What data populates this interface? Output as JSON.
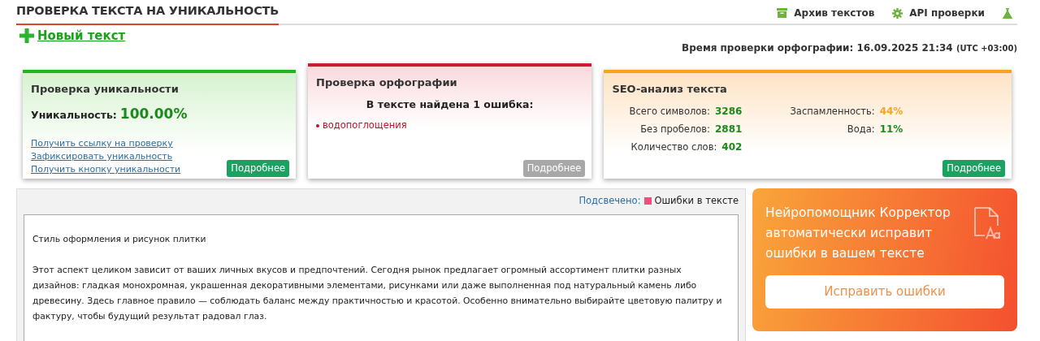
{
  "header": {
    "title": "ПРОВЕРКА ТЕКСТА НА УНИКАЛЬНОСТЬ",
    "links": [
      {
        "label": "Архив текстов",
        "kind": "archive"
      },
      {
        "label": "API проверки",
        "kind": "api"
      },
      {
        "kind": "lab"
      }
    ]
  },
  "new_text": {
    "label": "Новый текст"
  },
  "check_time": {
    "label": "Время проверки орфографии: 16.09.2025 21:34",
    "zone": "(UTC +03:00)"
  },
  "cards": [
    {
      "kind": "uniqueness",
      "title": "Проверка уникальности",
      "metric_label": "Уникальность:",
      "metric_value": "100.00%",
      "links": [
        "Получить ссылку на проверку",
        "Зафиксировать уникальность",
        "Получить кнопку уникальности"
      ],
      "button": {
        "label": "Подробнее",
        "disabled": false
      }
    },
    {
      "kind": "spelling",
      "title": "Проверка орфографии",
      "summary": "В тексте найдена 1 ошибка:",
      "errors": [
        "водопоглощения"
      ],
      "button": {
        "label": "Подробнее",
        "disabled": true
      }
    },
    {
      "kind": "seo",
      "title": "SEO-анализ текста",
      "stats_left": [
        {
          "label": "Всего символов:",
          "value": "3286",
          "color": "#1a8a1a"
        },
        {
          "label": "Без пробелов:",
          "value": "2881",
          "color": "#1a8a1a"
        },
        {
          "label": "Количество слов:",
          "value": "402",
          "color": "#1a8a1a"
        }
      ],
      "stats_right": [
        {
          "label": "Заспамленность:",
          "value": "44%",
          "color": "#f5a623"
        },
        {
          "label": "Вода:",
          "value": "11%",
          "color": "#1a8a1a"
        }
      ],
      "button": {
        "label": "Подробнее",
        "disabled": false
      }
    }
  ],
  "editor": {
    "highlight_label": "Подсвечено:",
    "legend": {
      "label": "Ошибки в тексте",
      "color": "#f0507a"
    },
    "paragraphs": [
      "Стиль оформления и рисунок плитки",
      "Этот аспект целиком зависит от ваших личных вкусов и предпочтений. Сегодня рынок предлагает огромный ассортимент плитки разных дизайнов: гладкая монохромная, украшенная декоративными элементами, рисунками или даже выполненная под натуральный камень либо древесину. Здесь главное правило — соблюдать баланс между практичностью и красотой. Особенно внимательно выбирайте цветовую палитру и фактуру, чтобы будущий результат радовал глаз."
    ]
  },
  "promo": {
    "text": "Нейропомощник Корректор автоматически исправит ошибки в вашем тексте",
    "button": "Исправить ошибки"
  }
}
